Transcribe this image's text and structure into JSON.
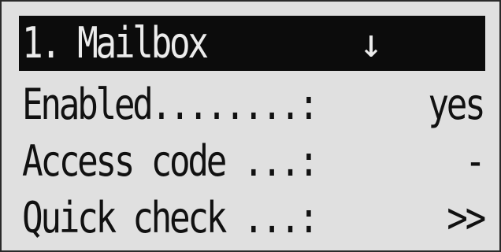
{
  "menu": {
    "title": "1. Mailbox",
    "scroll_arrow": "↓",
    "items": [
      {
        "label": "Enabled........:",
        "value": "yes"
      },
      {
        "label": "Access code ...:",
        "value": "-"
      },
      {
        "label": "Quick check ...:",
        "value": ">>"
      }
    ]
  },
  "colors": {
    "screen_background": "#e0e0e0",
    "highlight_bar": "#0c0c0c",
    "text": "#111111",
    "highlight_text": "#ececec"
  }
}
